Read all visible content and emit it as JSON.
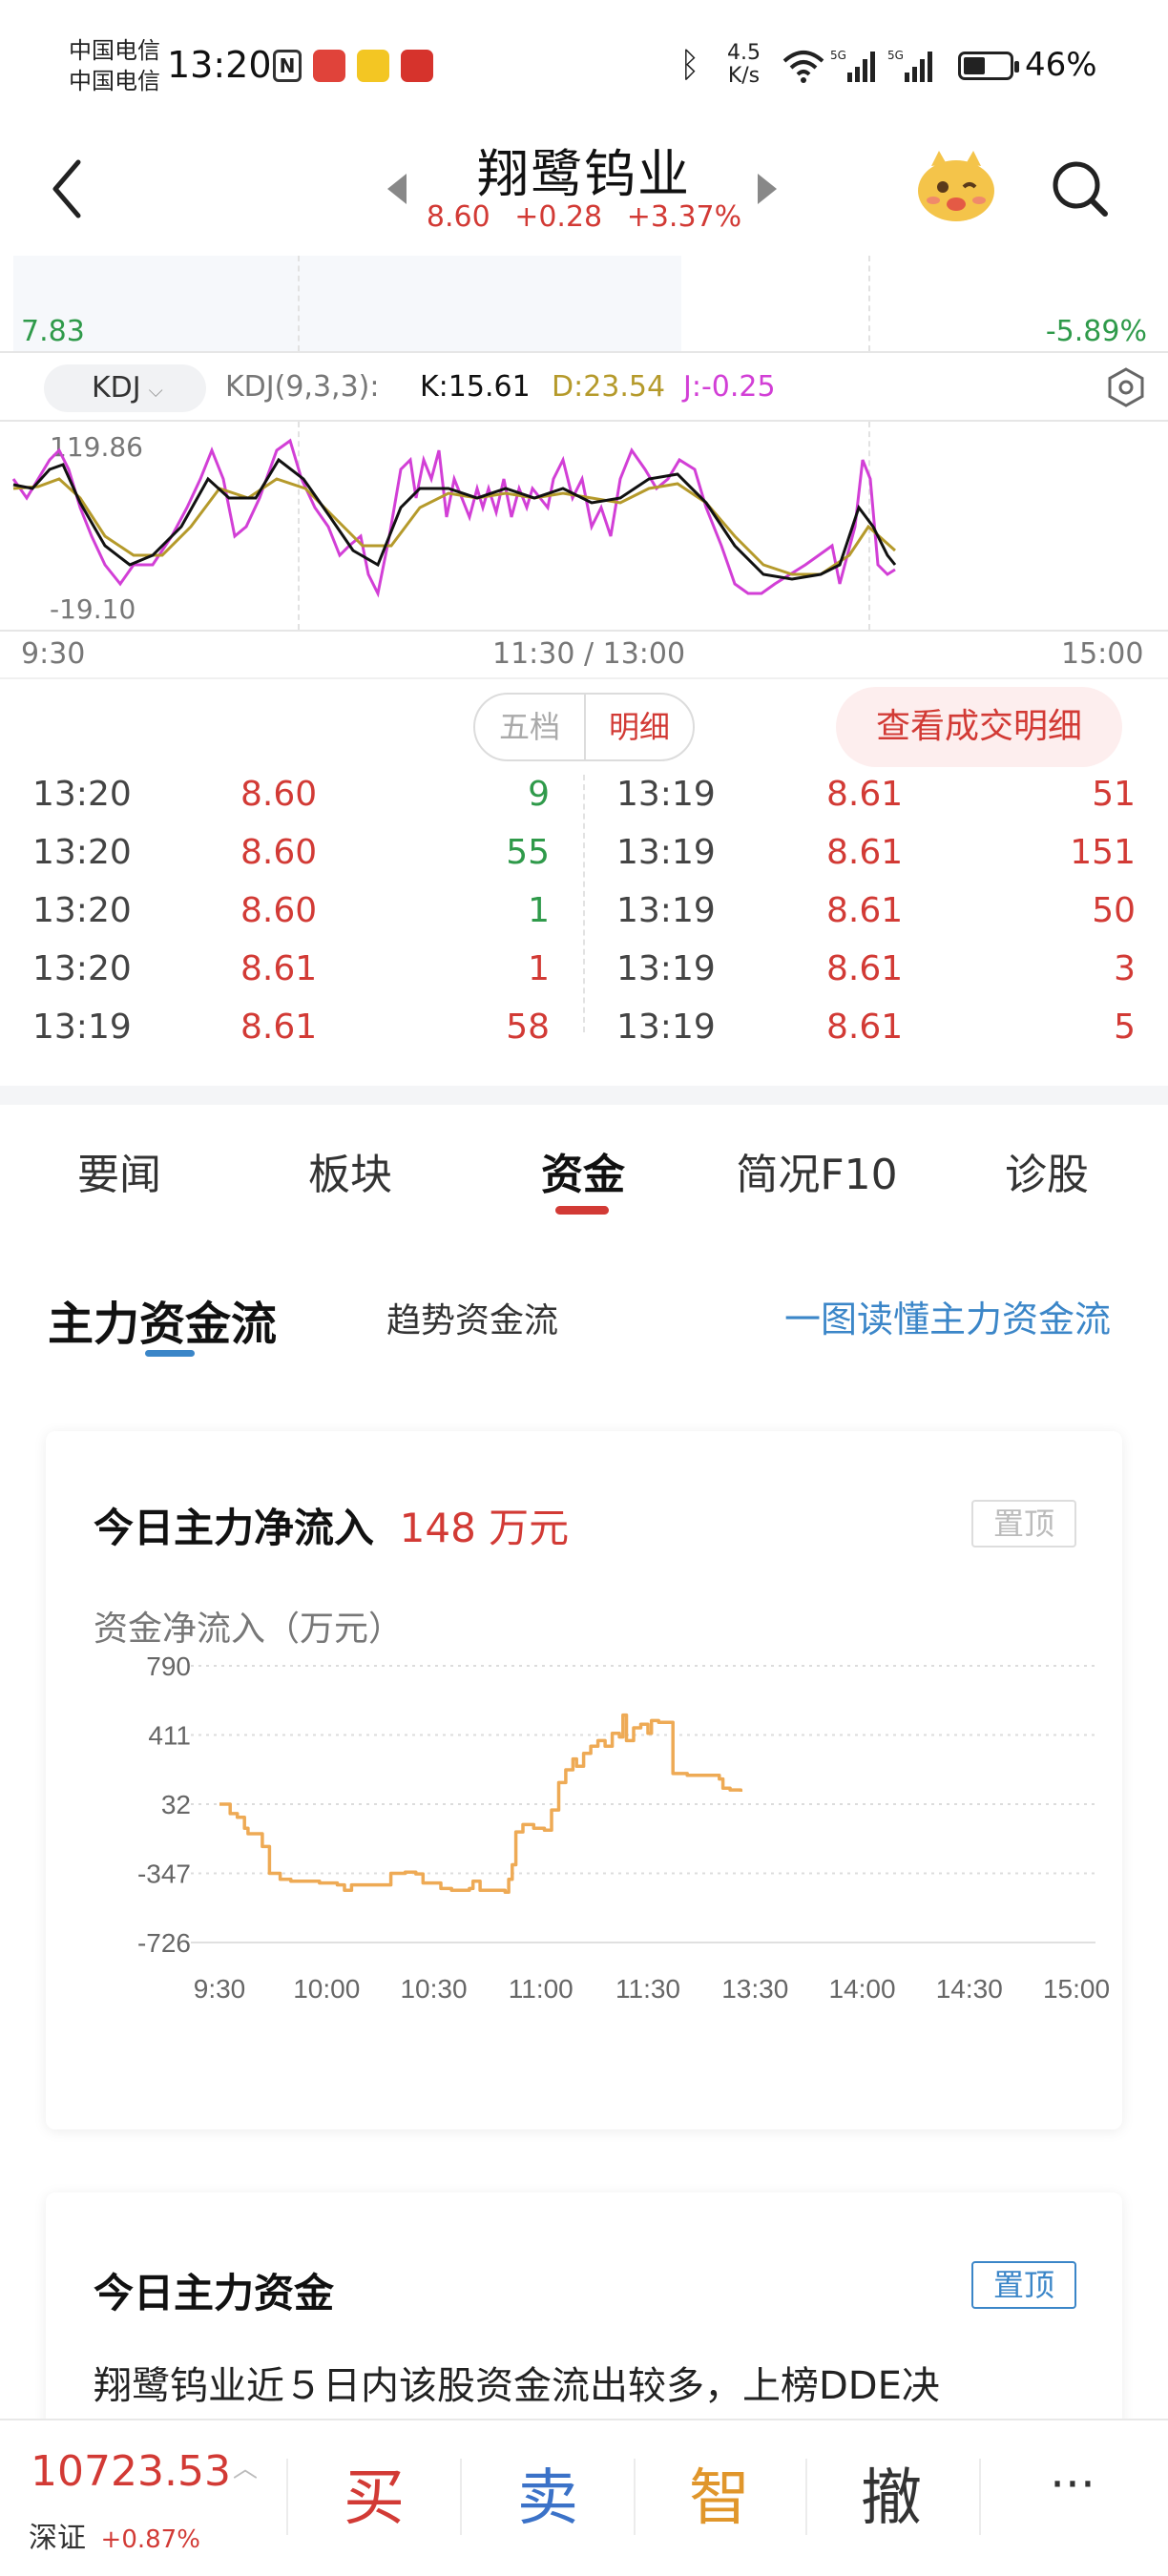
{
  "status_bar": {
    "carrier_1": "中国电信",
    "carrier_2": "中国电信",
    "time": "13:20",
    "net_speed_value": "4.5",
    "net_speed_unit": "K/s",
    "battery": "46%"
  },
  "header": {
    "back_icon": "chevron-left-icon",
    "stock_name": "翔鹭钨业",
    "price": "8.60",
    "change": "+0.28",
    "change_pct": "+3.37%",
    "search_icon": "search-icon"
  },
  "price_chart": {
    "low_price": "7.83",
    "low_pct": "-5.89%"
  },
  "indicator": {
    "selected": "KDJ",
    "params": "KDJ(9,3,3):",
    "k": "K:15.61",
    "d": "D:23.54",
    "j": "J:-0.25",
    "colors": {
      "k": "#111111",
      "d": "#b59a2b",
      "j": "#d23fd6"
    },
    "y_max": "119.86",
    "y_min": "-19.10",
    "time_start": "9:30",
    "time_mid": "11:30 / 13:00",
    "time_end": "15:00"
  },
  "trades": {
    "tab_five": "五档",
    "tab_detail": "明细",
    "view_details": "查看成交明细",
    "left": [
      {
        "time": "13:20",
        "price": "8.60",
        "vol": "9",
        "dir": "green"
      },
      {
        "time": "13:20",
        "price": "8.60",
        "vol": "55",
        "dir": "green"
      },
      {
        "time": "13:20",
        "price": "8.60",
        "vol": "1",
        "dir": "green"
      },
      {
        "time": "13:20",
        "price": "8.61",
        "vol": "1",
        "dir": "red"
      },
      {
        "time": "13:19",
        "price": "8.61",
        "vol": "58",
        "dir": "red"
      }
    ],
    "right": [
      {
        "time": "13:19",
        "price": "8.61",
        "vol": "51",
        "dir": "red"
      },
      {
        "time": "13:19",
        "price": "8.61",
        "vol": "151",
        "dir": "red"
      },
      {
        "time": "13:19",
        "price": "8.61",
        "vol": "50",
        "dir": "red"
      },
      {
        "time": "13:19",
        "price": "8.61",
        "vol": "3",
        "dir": "red"
      },
      {
        "time": "13:19",
        "price": "8.61",
        "vol": "5",
        "dir": "red"
      }
    ]
  },
  "section_tabs": [
    "要闻",
    "板块",
    "资金",
    "简况F10",
    "诊股"
  ],
  "money_flow": {
    "subtab_main": "主力资金流",
    "subtab_trend": "趋势资金流",
    "explain_link": "一图读懂主力资金流"
  },
  "card_inflow": {
    "title": "今日主力净流入",
    "amount": "148 万元",
    "pin": "置顶"
  },
  "card_capital": {
    "title": "今日主力资金",
    "pin": "置顶",
    "text": "翔鹭钨业近５日内该股资金流出较多，上榜DDE决"
  },
  "chart_data": {
    "type": "line",
    "ylabel": "资金净流入（万元）",
    "y_ticks": [
      "790",
      "411",
      "32",
      "-347",
      "-726"
    ],
    "ylim": [
      -726,
      790
    ],
    "x_ticks": [
      "9:30",
      "10:00",
      "10:30",
      "11:00",
      "11:30",
      "13:30",
      "14:00",
      "14:30",
      "15:00"
    ],
    "x_minutes": [
      0,
      30,
      60,
      90,
      120,
      150,
      180,
      210,
      240
    ],
    "series": [
      {
        "color": "#eeaa55",
        "points": [
          [
            0,
            32
          ],
          [
            3,
            -20
          ],
          [
            5,
            -40
          ],
          [
            7,
            -100
          ],
          [
            8,
            -130
          ],
          [
            10,
            -130
          ],
          [
            12,
            -200
          ],
          [
            14,
            -347
          ],
          [
            17,
            -380
          ],
          [
            20,
            -390
          ],
          [
            24,
            -390
          ],
          [
            28,
            -400
          ],
          [
            33,
            -410
          ],
          [
            35,
            -440
          ],
          [
            37,
            -410
          ],
          [
            40,
            -410
          ],
          [
            45,
            -410
          ],
          [
            48,
            -347
          ],
          [
            52,
            -340
          ],
          [
            55,
            -350
          ],
          [
            57,
            -400
          ],
          [
            62,
            -430
          ],
          [
            65,
            -440
          ],
          [
            70,
            -430
          ],
          [
            71,
            -390
          ],
          [
            73,
            -440
          ],
          [
            78,
            -440
          ],
          [
            80,
            -450
          ],
          [
            81,
            -380
          ],
          [
            82,
            -300
          ],
          [
            83,
            -120
          ],
          [
            85,
            -80
          ],
          [
            88,
            -100
          ],
          [
            91,
            -110
          ],
          [
            93,
            0
          ],
          [
            95,
            150
          ],
          [
            97,
            220
          ],
          [
            99,
            280
          ],
          [
            100,
            240
          ],
          [
            102,
            310
          ],
          [
            104,
            350
          ],
          [
            106,
            380
          ],
          [
            108,
            350
          ],
          [
            110,
            420
          ],
          [
            112,
            400
          ],
          [
            113,
            520
          ],
          [
            114,
            380
          ],
          [
            116,
            450
          ],
          [
            118,
            470
          ],
          [
            120,
            420
          ],
          [
            121,
            490
          ],
          [
            123,
            480
          ],
          [
            126,
            480
          ],
          [
            127,
            200
          ],
          [
            131,
            190
          ],
          [
            137,
            190
          ],
          [
            140,
            170
          ],
          [
            141,
            120
          ],
          [
            143,
            110
          ],
          [
            146,
            100
          ]
        ]
      }
    ]
  },
  "bottom_bar": {
    "index_value": "10723.53",
    "index_name": "深证",
    "index_change": "+0.87%",
    "buy": "买",
    "sell": "卖",
    "smart": "智",
    "cancel": "撤",
    "more": "···"
  }
}
